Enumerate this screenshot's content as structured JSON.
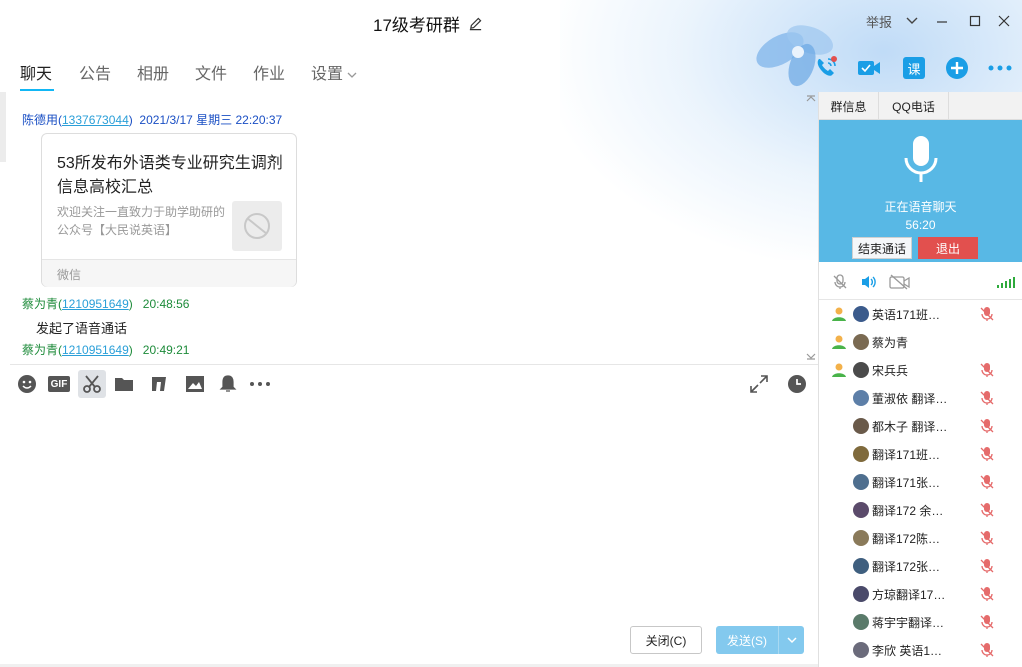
{
  "window": {
    "title": "17级考研群",
    "report_label": "举报"
  },
  "tabs": [
    {
      "label": "聊天"
    },
    {
      "label": "公告"
    },
    {
      "label": "相册"
    },
    {
      "label": "文件"
    },
    {
      "label": "作业"
    },
    {
      "label": "设置"
    }
  ],
  "top_icons": [
    "voice-call-icon",
    "video-call-icon",
    "course-icon",
    "add-app-icon",
    "more-icon"
  ],
  "top_icons_labels": {
    "course": "课"
  },
  "messages": {
    "m1": {
      "sender": "陈德用(",
      "qq": "1337673044",
      "close": ")",
      "time": "2021/3/17 星期三 22:20:37"
    },
    "card": {
      "title": "53所发布外语类专业研究生调剂信息高校汇总",
      "desc": "欢迎关注一直致力于助学助研的公众号【大民说英语】",
      "source": "微信"
    },
    "m2": {
      "sender": "蔡为青(",
      "qq": "1210951649",
      "close": ")",
      "time": "20:48:56"
    },
    "system_text": "发起了语音通话",
    "m3": {
      "sender": "蔡为青(",
      "qq": "1210951649",
      "close": ")",
      "time": "20:49:21"
    }
  },
  "toolbar_icons": [
    "emoji-icon",
    "gif-icon",
    "scissors-icon",
    "folder-icon",
    "music-icon",
    "image-icon",
    "bell-icon",
    "more-icon",
    "expand-icon",
    "history-clock-icon"
  ],
  "toolbar_labels": {
    "gif": "GIF"
  },
  "buttons": {
    "close": "关闭(C)",
    "send": "发送(S)"
  },
  "side": {
    "tabs": [
      {
        "label": "群信息"
      },
      {
        "label": "QQ电话"
      }
    ],
    "voice_status": "正在语音聊天",
    "voice_time": "56:20",
    "end_call": "结束通话",
    "exit": "退出"
  },
  "members": [
    {
      "name": "英语171班…",
      "role": "owner",
      "muted": true
    },
    {
      "name": "蔡为青",
      "role": "owner",
      "muted": false
    },
    {
      "name": "宋兵兵",
      "role": "owner",
      "muted": true
    },
    {
      "name": "董淑依 翻译…",
      "role": "",
      "muted": true
    },
    {
      "name": "都木子 翻译…",
      "role": "",
      "muted": true
    },
    {
      "name": "翻译171班…",
      "role": "",
      "muted": true
    },
    {
      "name": "翻译171张…",
      "role": "",
      "muted": true
    },
    {
      "name": "翻译172 余…",
      "role": "",
      "muted": true
    },
    {
      "name": "翻译172陈…",
      "role": "",
      "muted": true
    },
    {
      "name": "翻译172张…",
      "role": "",
      "muted": true
    },
    {
      "name": "方琼翻译17…",
      "role": "",
      "muted": true
    },
    {
      "name": "蒋宇宇翻译…",
      "role": "",
      "muted": true
    },
    {
      "name": "李欣 英语1…",
      "role": "",
      "muted": true
    }
  ],
  "colors": {
    "accent": "#12b7f5",
    "sender_blue": "#1a4fc4",
    "sender_green": "#1d8b3a",
    "voice_panel": "#58b8e5",
    "exit_red": "#e2504e",
    "send_button": "#83c9ee"
  }
}
